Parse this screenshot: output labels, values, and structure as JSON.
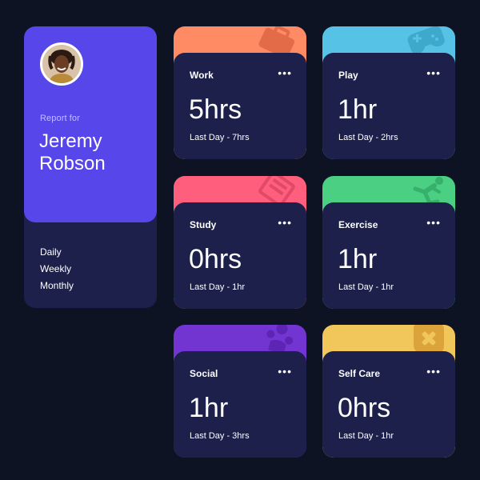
{
  "profile": {
    "report_label": "Report for",
    "first_name": "Jeremy",
    "last_name": "Robson",
    "periods": [
      "Daily",
      "Weekly",
      "Monthly"
    ]
  },
  "activities": [
    {
      "title": "Work",
      "current": "5hrs",
      "previous": "Last Day - 7hrs",
      "color": "#ff8b64",
      "icon": "briefcase-icon"
    },
    {
      "title": "Play",
      "current": "1hr",
      "previous": "Last Day - 2hrs",
      "color": "#55c2e6",
      "icon": "gamepad-icon"
    },
    {
      "title": "Study",
      "current": "0hrs",
      "previous": "Last Day - 1hr",
      "color": "#ff5e7d",
      "icon": "book-icon"
    },
    {
      "title": "Exercise",
      "current": "1hr",
      "previous": "Last Day - 1hr",
      "color": "#4bcf82",
      "icon": "running-icon"
    },
    {
      "title": "Social",
      "current": "1hr",
      "previous": "Last Day - 3hrs",
      "color": "#7335d2",
      "icon": "social-icon"
    },
    {
      "title": "Self Care",
      "current": "0hrs",
      "previous": "Last Day - 1hr",
      "color": "#f1c75b",
      "icon": "self-care-icon"
    }
  ],
  "menu_glyph": "•••",
  "colors": {
    "page_bg": "#0d1323",
    "card_bg": "#1c204b",
    "profile_bg": "#5747ea",
    "muted_text": "#bdc1ff"
  }
}
